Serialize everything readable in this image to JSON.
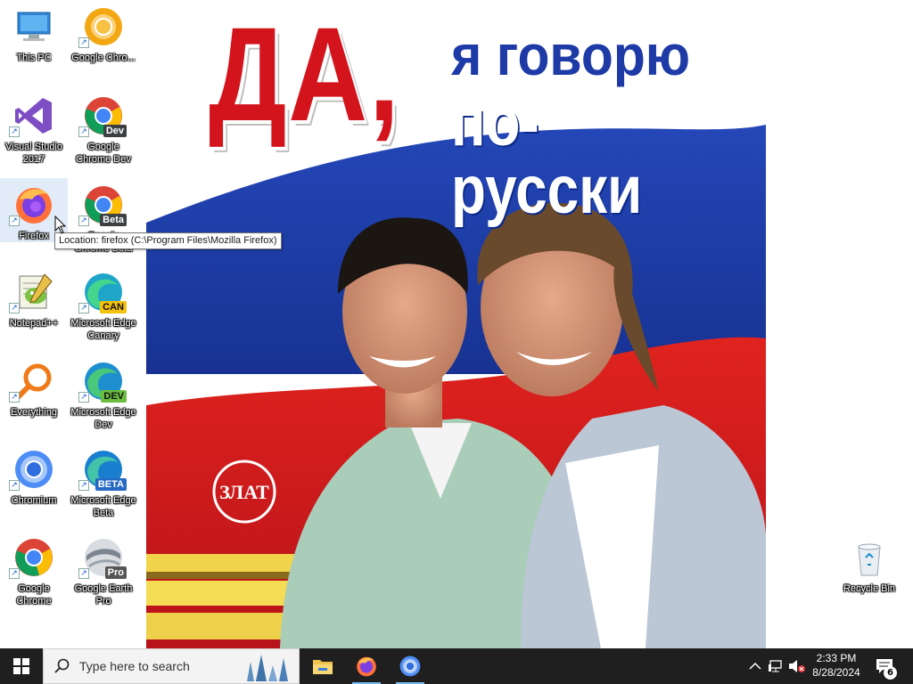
{
  "desktop": {
    "icons": [
      {
        "id": "this-pc",
        "label": "This PC",
        "icon": "computer-icon"
      },
      {
        "id": "google-chrome-canary",
        "label": "Google Chro...",
        "icon": "chrome-canary-icon"
      },
      {
        "id": "visual-studio",
        "label": "Visual Studio 2017",
        "icon": "visual-studio-icon"
      },
      {
        "id": "chrome-dev",
        "label": "Google Chrome Dev",
        "icon": "chrome-dev-icon",
        "badge": "Dev"
      },
      {
        "id": "firefox",
        "label": "Firefox",
        "icon": "firefox-icon"
      },
      {
        "id": "chrome-beta",
        "label": "Google Chrome Beta",
        "icon": "chrome-beta-icon",
        "badge": "Beta"
      },
      {
        "id": "notepad-plus",
        "label": "Notepad++",
        "icon": "notepad-plus-icon"
      },
      {
        "id": "edge-canary",
        "label": "Microsoft Edge Canary",
        "icon": "edge-canary-icon",
        "badge": "CAN"
      },
      {
        "id": "everything",
        "label": "Everything",
        "icon": "everything-search-icon"
      },
      {
        "id": "edge-dev",
        "label": "Microsoft Edge Dev",
        "icon": "edge-dev-icon",
        "badge": "DEV"
      },
      {
        "id": "chromium",
        "label": "Chromium",
        "icon": "chromium-icon"
      },
      {
        "id": "edge-beta",
        "label": "Microsoft Edge Beta",
        "icon": "edge-beta-icon",
        "badge": "BETA"
      },
      {
        "id": "google-chrome",
        "label": "Google Chrome",
        "icon": "chrome-icon"
      },
      {
        "id": "google-earth-pro",
        "label": "Google Earth Pro",
        "icon": "google-earth-icon",
        "badge": "Pro"
      },
      {
        "id": "recycle-bin",
        "label": "Recycle Bin",
        "icon": "recycle-bin-icon"
      }
    ],
    "tooltip": "Location: firefox (C:\\Program Files\\Mozilla Firefox)"
  },
  "wallpaper": {
    "line1": "ДА,",
    "line2": "я говорю",
    "line3": "по-русски",
    "colors": {
      "white": "#ffffff",
      "blue": "#1a3da8",
      "red": "#d4141c"
    }
  },
  "taskbar": {
    "search_placeholder": "Type here to search",
    "apps": [
      {
        "id": "file-explorer",
        "icon": "folder-icon"
      },
      {
        "id": "firefox",
        "icon": "firefox-icon"
      },
      {
        "id": "chromium",
        "icon": "chromium-icon"
      }
    ],
    "clock": {
      "time": "2:33 PM",
      "date": "8/28/2024"
    },
    "notifications_count": "6"
  }
}
